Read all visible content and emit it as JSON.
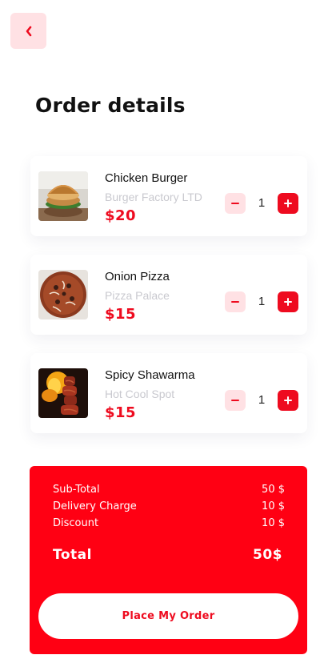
{
  "header": {
    "back_icon": "chevron-left-icon",
    "title": "Order details"
  },
  "colors": {
    "accent": "#ee0b1f",
    "accent_light": "#ffe1e4",
    "summary_bg": "#ff0013",
    "muted_text": "#c9c9cf"
  },
  "items": [
    {
      "name": "Chicken Burger",
      "vendor": "Burger Factory LTD",
      "price": "$20",
      "quantity": "1",
      "image": "burger-photo"
    },
    {
      "name": "Onion Pizza",
      "vendor": "Pizza Palace",
      "price": "$15",
      "quantity": "1",
      "image": "pizza-photo"
    },
    {
      "name": "Spicy Shawarma",
      "vendor": "Hot Cool Spot",
      "price": "$15",
      "quantity": "1",
      "image": "shawarma-photo"
    }
  ],
  "summary": {
    "subtotal_label": "Sub-Total",
    "subtotal_value": "50 $",
    "delivery_label": "Delivery Charge",
    "delivery_value": "10 $",
    "discount_label": "Discount",
    "discount_value": "10 $",
    "total_label": "Total",
    "total_value": "50$",
    "place_order_label": "Place My Order"
  }
}
